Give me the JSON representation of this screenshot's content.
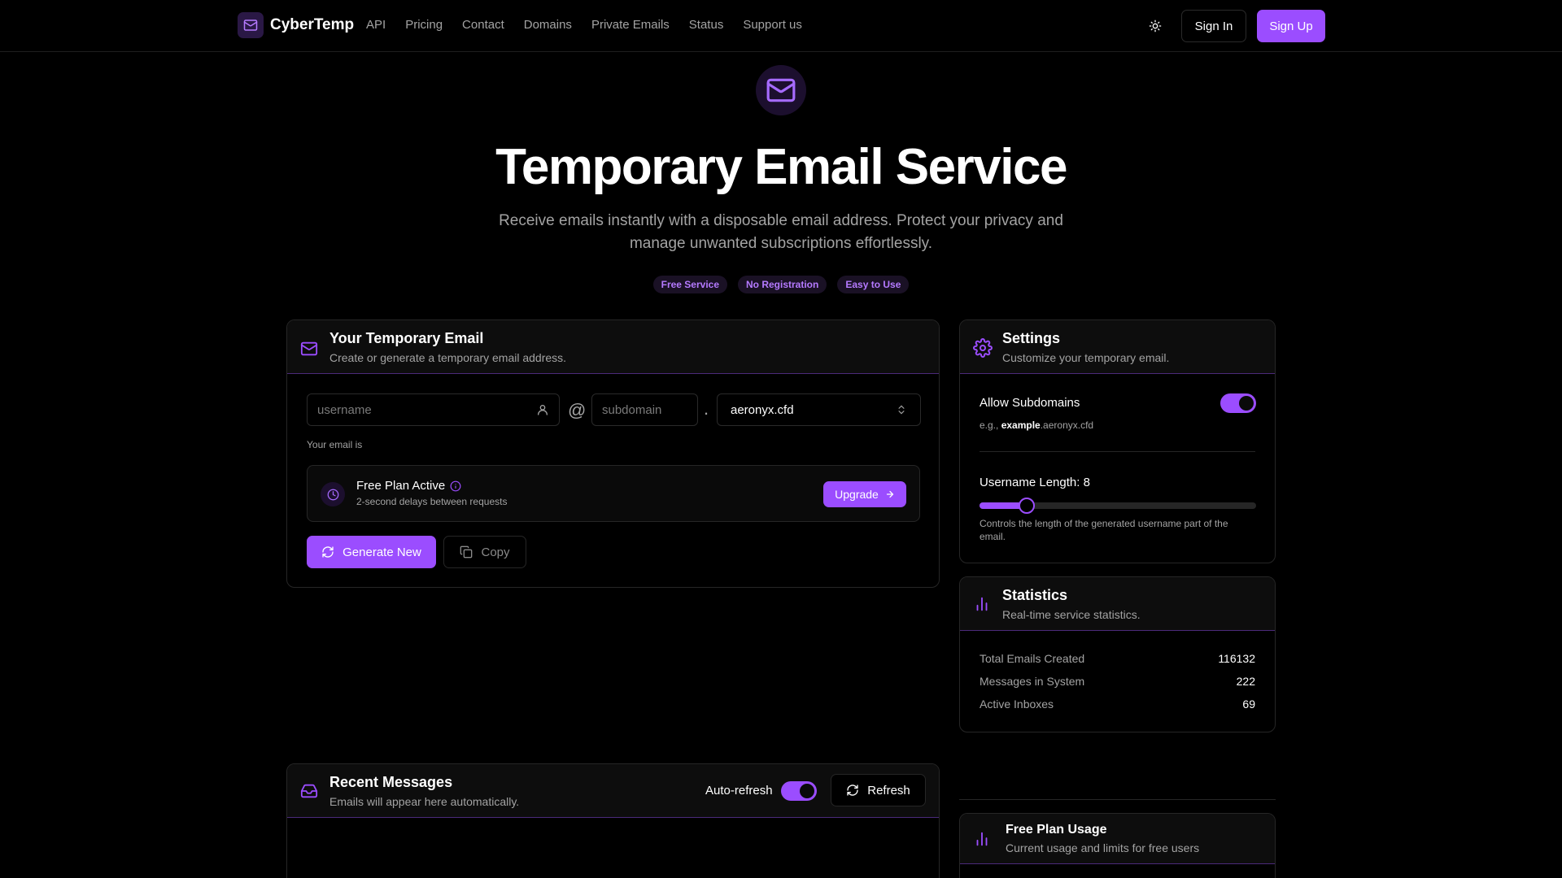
{
  "nav": {
    "brand": "CyberTemp",
    "links": [
      "API",
      "Pricing",
      "Contact",
      "Domains",
      "Private Emails",
      "Status",
      "Support us"
    ],
    "signin": "Sign In",
    "signup": "Sign Up"
  },
  "hero": {
    "title": "Temporary Email Service",
    "subtitle": "Receive emails instantly with a disposable email address. Protect your privacy and manage unwanted subscriptions effortlessly.",
    "badges": [
      "Free Service",
      "No Registration",
      "Easy to Use"
    ]
  },
  "email_card": {
    "title": "Your Temporary Email",
    "desc": "Create or generate a temporary email address.",
    "username_placeholder": "username",
    "at": "@",
    "subdomain_placeholder": "subdomain",
    "dot": ".",
    "domain": "aeronyx.cfd",
    "your_email_is": "Your email is",
    "plan_title": "Free Plan Active",
    "plan_desc": "2-second delays between requests",
    "upgrade": "Upgrade",
    "generate": "Generate New",
    "copy": "Copy"
  },
  "settings": {
    "title": "Settings",
    "desc": "Customize your temporary email.",
    "allow_subdomains": "Allow Subdomains",
    "example_prefix": "e.g., ",
    "example_bold": "example",
    "example_suffix": ".aeronyx.cfd",
    "username_length_label": "Username Length: 8",
    "username_length_value": 8,
    "slider_fraction": 0.17,
    "length_help": "Controls the length of the generated username part of the email.",
    "allow_subdomains_on": true
  },
  "stats": {
    "title": "Statistics",
    "desc": "Real-time service statistics.",
    "rows": [
      {
        "label": "Total Emails Created",
        "value": "116132"
      },
      {
        "label": "Messages in System",
        "value": "222"
      },
      {
        "label": "Active Inboxes",
        "value": "69"
      }
    ]
  },
  "messages": {
    "title": "Recent Messages",
    "desc": "Emails will appear here automatically.",
    "auto_refresh": "Auto-refresh",
    "auto_refresh_on": true,
    "refresh": "Refresh"
  },
  "usage": {
    "title": "Free Plan Usage",
    "desc": "Current usage and limits for free users"
  },
  "colors": {
    "accent": "#9b4dff",
    "background": "#000000",
    "card_header": "#0d0d0d"
  },
  "icons": [
    "mail-icon",
    "sun-icon",
    "user-icon",
    "chevrons-up-down-icon",
    "clock-icon",
    "info-icon",
    "arrow-right-icon",
    "refresh-icon",
    "copy-icon",
    "gear-icon",
    "bar-chart-icon",
    "inbox-icon"
  ]
}
